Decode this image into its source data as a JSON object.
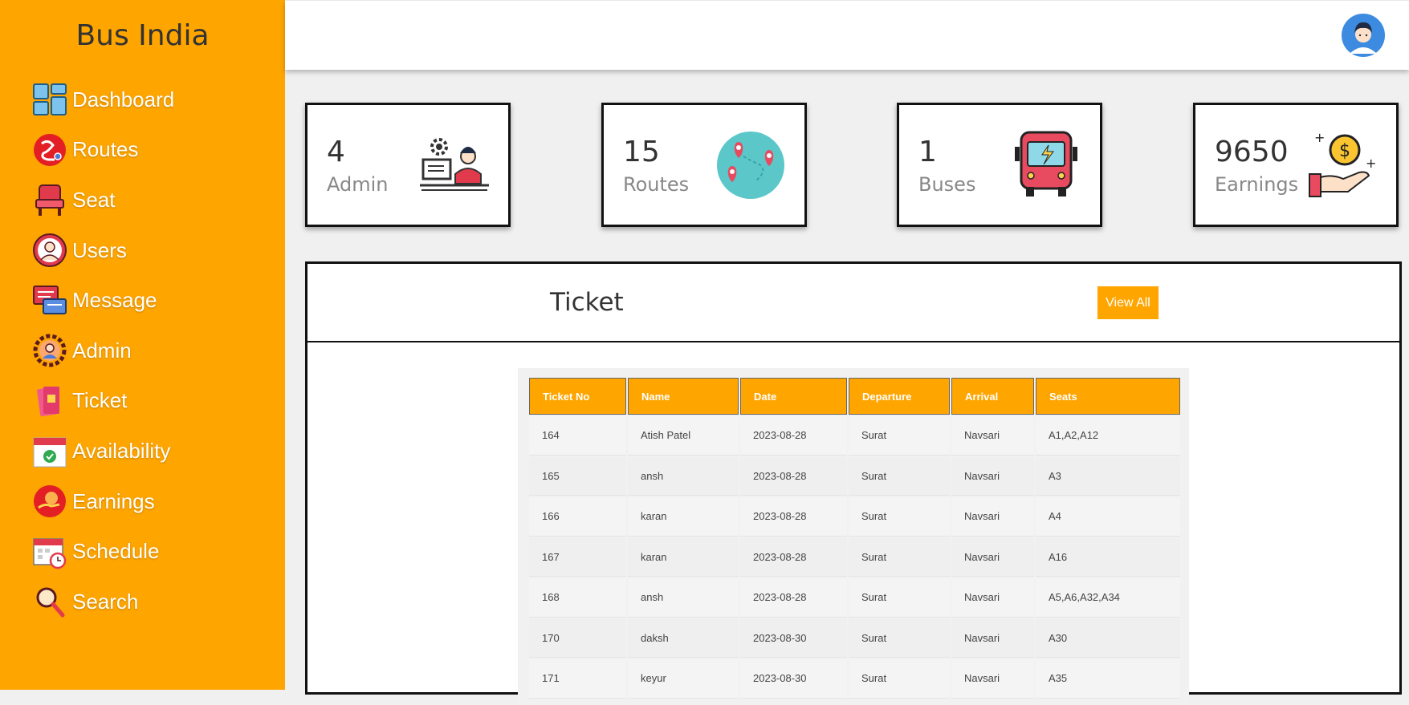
{
  "sidebar": {
    "brand": "Bus India",
    "items": [
      {
        "label": "Dashboard",
        "icon": "dashboard-icon"
      },
      {
        "label": "Routes",
        "icon": "routes-icon"
      },
      {
        "label": "Seat",
        "icon": "seat-icon"
      },
      {
        "label": "Users",
        "icon": "users-icon"
      },
      {
        "label": "Message",
        "icon": "message-icon"
      },
      {
        "label": "Admin",
        "icon": "admin-icon"
      },
      {
        "label": "Ticket",
        "icon": "ticket-icon"
      },
      {
        "label": "Availability",
        "icon": "availability-icon"
      },
      {
        "label": "Earnings",
        "icon": "earnings-icon"
      },
      {
        "label": "Schedule",
        "icon": "schedule-icon"
      },
      {
        "label": "Search",
        "icon": "search-icon"
      }
    ]
  },
  "header": {
    "avatar_icon": "user-avatar-icon"
  },
  "stats": [
    {
      "value": "4",
      "label": "Admin",
      "icon": "admin-desk-icon"
    },
    {
      "value": "15",
      "label": "Routes",
      "icon": "map-pins-icon"
    },
    {
      "value": "1",
      "label": "Buses",
      "icon": "bus-icon"
    },
    {
      "value": "9650",
      "label": "Earnings",
      "icon": "money-hand-icon"
    }
  ],
  "ticket_panel": {
    "title": "Ticket",
    "view_all": "View All",
    "columns": [
      "Ticket No",
      "Name",
      "Date",
      "Departure",
      "Arrival",
      "Seats"
    ],
    "rows": [
      [
        "164",
        "Atish Patel",
        "2023-08-28",
        "Surat",
        "Navsari",
        "A1,A2,A12"
      ],
      [
        "165",
        "ansh",
        "2023-08-28",
        "Surat",
        "Navsari",
        "A3"
      ],
      [
        "166",
        "karan",
        "2023-08-28",
        "Surat",
        "Navsari",
        "A4"
      ],
      [
        "167",
        "karan",
        "2023-08-28",
        "Surat",
        "Navsari",
        "A16"
      ],
      [
        "168",
        "ansh",
        "2023-08-28",
        "Surat",
        "Navsari",
        "A5,A6,A32,A34"
      ],
      [
        "170",
        "daksh",
        "2023-08-30",
        "Surat",
        "Navsari",
        "A30"
      ],
      [
        "171",
        "keyur",
        "2023-08-30",
        "Surat",
        "Navsari",
        "A35"
      ]
    ]
  },
  "colors": {
    "accent": "#ffa500",
    "header_bg": "#ffffff",
    "page_bg": "#f0f0f0"
  }
}
